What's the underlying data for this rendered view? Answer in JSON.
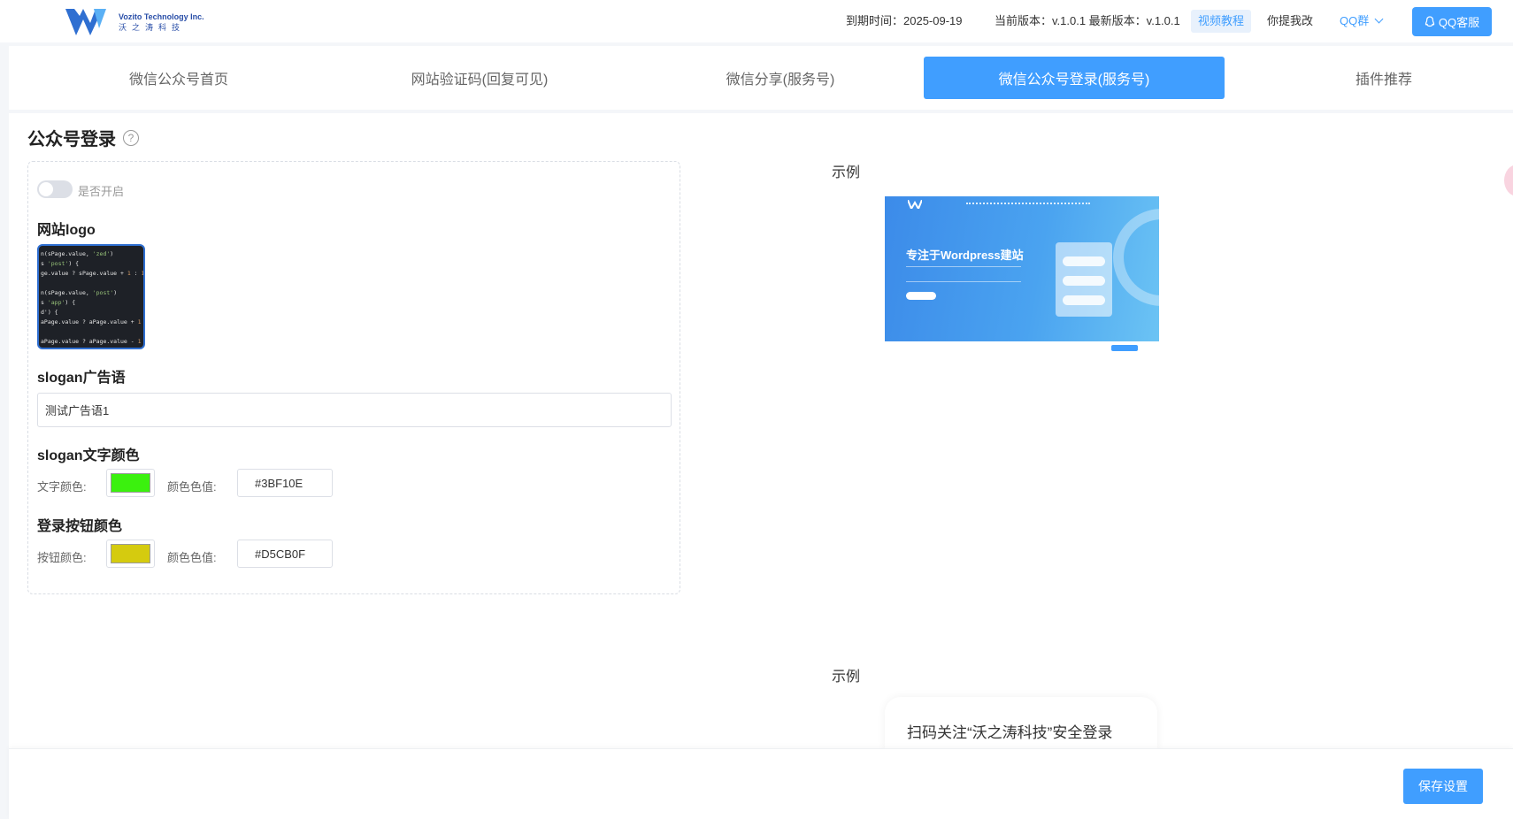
{
  "header": {
    "logo_en": "Vozito Technology Inc.",
    "logo_cn": "沃之涛科技",
    "expire": "到期时间：2025-09-19",
    "version": "当前版本：v.1.0.1 最新版本：v.1.0.1",
    "video_tutorial": "视频教程",
    "feedback": "你提我改",
    "qq_group": "QQ群",
    "qq_service": "QQ客服"
  },
  "tabs": [
    {
      "label": "微信公众号首页",
      "active": false
    },
    {
      "label": "网站验证码(回复可见)",
      "active": false
    },
    {
      "label": "微信分享(服务号)",
      "active": false
    },
    {
      "label": "微信公众号登录(服务号)",
      "active": true
    },
    {
      "label": "插件推荐",
      "active": false
    }
  ],
  "section": {
    "title": "公众号登录",
    "help": "?"
  },
  "form": {
    "toggle_label": "是否开启",
    "toggle_on": false,
    "logo_label": "网站logo",
    "slogan_label": "slogan广告语",
    "slogan_value": "测试广告语1",
    "slogan_color_label": "slogan文字颜色",
    "text_color_label": "文字颜色:",
    "color_value_label": "颜色色值:",
    "slogan_color": "#3BF10E",
    "btn_color_label": "登录按钮颜色",
    "button_color_label": "按钮颜色:",
    "button_color_value_label": "颜色色值:",
    "button_color": "#D5CB0F"
  },
  "examples": {
    "label1": "示例",
    "preview1_title": "专注于Wordpress建站",
    "label2": "示例",
    "preview2_text": "扫码关注“沃之涛科技”安全登录"
  },
  "footer": {
    "save_label": "保存设置"
  },
  "colors": {
    "primary": "#409eff",
    "slogan_swatch": "#3BF10E",
    "button_swatch": "#D5CB0F"
  }
}
